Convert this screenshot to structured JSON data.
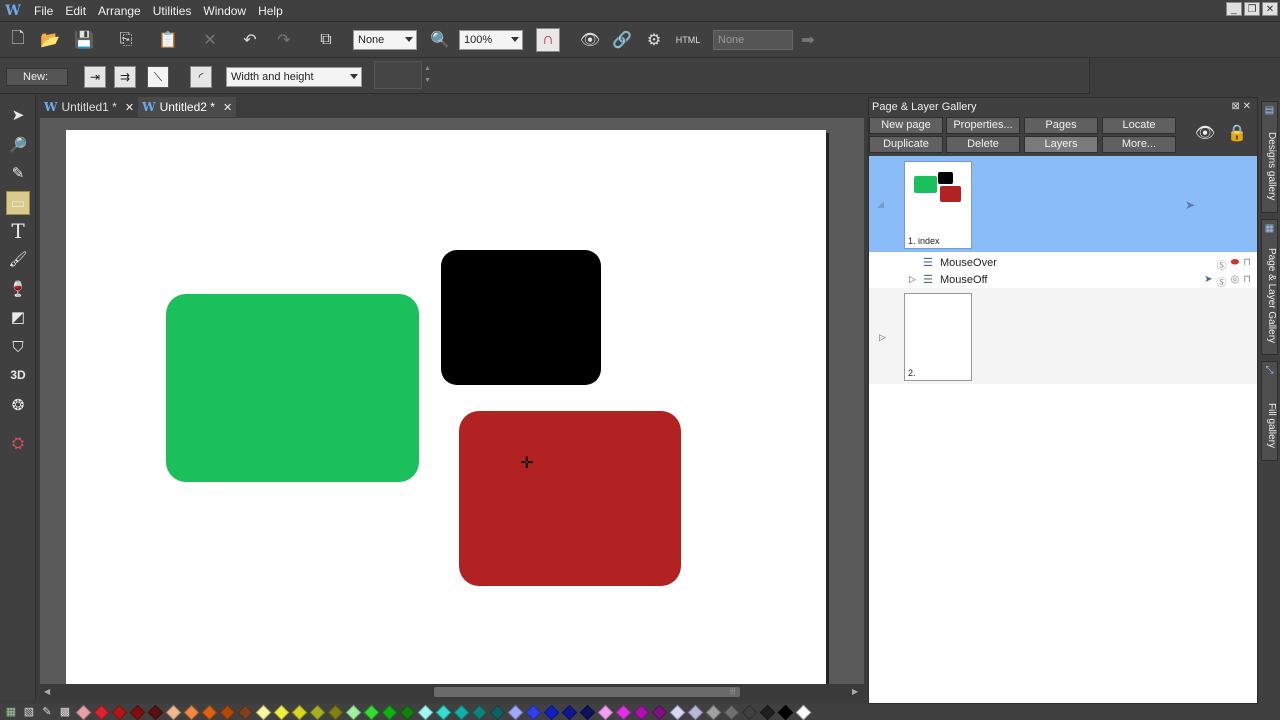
{
  "app": {
    "logo_letter": "W"
  },
  "menu": [
    "File",
    "Edit",
    "Arrange",
    "Utilities",
    "Window",
    "Help"
  ],
  "window_controls": [
    "_",
    "❐",
    "✕"
  ],
  "toolbar": {
    "quality_select": "None",
    "zoom_select": "100%",
    "html_label": "HTML",
    "none_disabled": "None"
  },
  "shape_toolbar": {
    "new_label": "New:",
    "size_select": "Width and height",
    "number_field": ""
  },
  "doc_tabs": [
    {
      "label": "Untitled1 *",
      "close": "✕"
    },
    {
      "label": "Untitled2 *",
      "close": "✕"
    }
  ],
  "gallery": {
    "title": "Page & Layer Gallery",
    "title_buttons": "⊠ ✕",
    "buttons": {
      "new_page": "New page",
      "properties": "Properties...",
      "pages": "Pages",
      "locate": "Locate",
      "duplicate": "Duplicate",
      "delete": "Delete",
      "layers": "Layers",
      "more": "More..."
    },
    "pages": [
      {
        "label": "1. index"
      },
      {
        "label": "2."
      }
    ],
    "layers": [
      {
        "name": "MouseOver"
      },
      {
        "name": "MouseOff"
      }
    ]
  },
  "side_tabs": [
    "Designs gallery",
    "Page & Layer Gallery",
    "Fill gallery"
  ],
  "canvas": {
    "shape_colors": {
      "green": "#1bbf5c",
      "black": "#000000",
      "red": "#b22222"
    }
  },
  "palette": [
    "#e6a0a8",
    "#e0202a",
    "#b01818",
    "#801010",
    "#5a1010",
    "#f0b890",
    "#f08840",
    "#e06010",
    "#b04808",
    "#804020",
    "#f8f8a0",
    "#f0f040",
    "#d8d820",
    "#a8b020",
    "#808010",
    "#a0f0a0",
    "#30e030",
    "#10b010",
    "#108010",
    "#a0f8f0",
    "#30e0d0",
    "#10b0a8",
    "#108078",
    "#106060",
    "#a0a8f8",
    "#3040f0",
    "#1020c0",
    "#101890",
    "#101060",
    "#f0a0f0",
    "#e030e0",
    "#b010b0",
    "#801080",
    "#d8d8f8",
    "#b8b8d8",
    "#a0a0a0",
    "#707070",
    "#404040",
    "#202020",
    "#000000",
    "#ffffff"
  ]
}
